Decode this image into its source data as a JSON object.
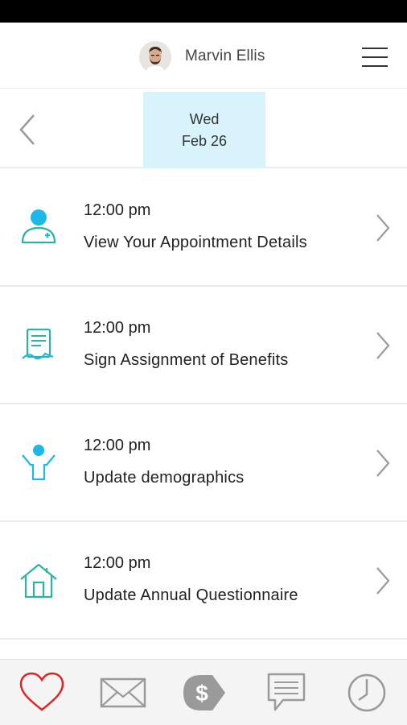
{
  "header": {
    "user_name": "Marvin Ellis",
    "avatar_icon": "avatar",
    "menu_icon": "hamburger-menu-icon"
  },
  "date_bar": {
    "selected_day": "Wed",
    "selected_date": "Feb 26",
    "back_icon": "chevron-left-icon"
  },
  "colors": {
    "accent": "#1bb8e8",
    "teal_icon": "#2cb3a4",
    "date_chip_bg": "#d8f3fc",
    "favorites_red": "#e02424",
    "tab_icon_gray": "#9a9a9a"
  },
  "tasks": [
    {
      "time": "12:00 pm",
      "title": "View Your Appointment Details",
      "icon": "doctor-icon"
    },
    {
      "time": "12:00 pm",
      "title": "Sign Assignment of Benefits",
      "icon": "signature-document-icon"
    },
    {
      "time": "12:00 pm",
      "title": "Update demographics",
      "icon": "person-raised-arms-icon"
    },
    {
      "time": "12:00 pm",
      "title": "Update Annual Questionnaire",
      "icon": "home-icon"
    }
  ],
  "tabs": [
    {
      "name": "health",
      "icon": "heart-icon"
    },
    {
      "name": "messages",
      "icon": "mail-icon"
    },
    {
      "name": "billing",
      "icon": "dollar-tag-icon"
    },
    {
      "name": "chat",
      "icon": "chat-bubble-icon"
    },
    {
      "name": "history",
      "icon": "clock-icon"
    }
  ]
}
